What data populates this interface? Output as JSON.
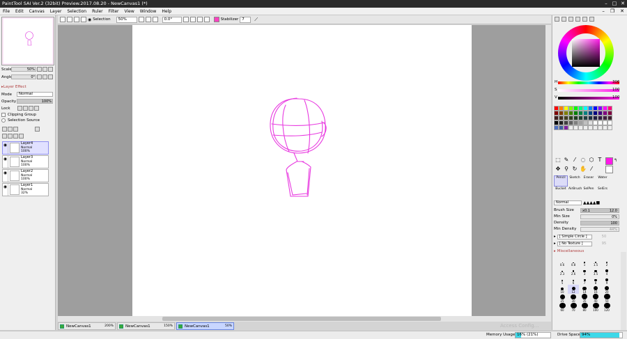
{
  "title": "PaintTool SAI Ver.2 (32bit) Preview.2017.08.20 - NewCanvas1 (*)",
  "menu": [
    "File",
    "Edit",
    "Canvas",
    "Layer",
    "Selection",
    "Ruler",
    "Filter",
    "View",
    "Window",
    "Help"
  ],
  "toolbar": {
    "selection_label": "Selection",
    "zoom": "50%",
    "angle": "0.0°",
    "stabilizer_label": "Stabilizer",
    "stabilizer_value": "7"
  },
  "left": {
    "scale_label": "Scale",
    "scale_value": "50%",
    "angle_label": "Angle",
    "angle_value": "0°",
    "layer_effect": "Layer Effect",
    "mode_label": "Mode",
    "mode_value": "Normal",
    "opacity_label": "Opacity",
    "opacity_value": "100%",
    "lock_label": "Lock",
    "clipping_group": "Clipping Group",
    "selection_source": "Selection Source"
  },
  "layers": [
    {
      "name": "Layer4",
      "mode": "Normal",
      "opacity": "100%",
      "selected": true
    },
    {
      "name": "Layer3",
      "mode": "Normal",
      "opacity": "100%",
      "selected": false
    },
    {
      "name": "Layer2",
      "mode": "Normal",
      "opacity": "100%",
      "selected": false
    },
    {
      "name": "Layer1",
      "mode": "Normal",
      "opacity": "32%",
      "selected": false
    }
  ],
  "canvas_tabs": [
    {
      "name": "NewCanvas1",
      "zoom": "200%"
    },
    {
      "name": "NewCanvas1",
      "zoom": "150%"
    },
    {
      "name": "NewCanvas1",
      "zoom": "50%"
    }
  ],
  "status": {
    "memory_label": "Memory Usage",
    "memory_value": "16% (21%)",
    "drive_label": "Drive Space",
    "drive_value": "94%",
    "watermark": "Access Config…"
  },
  "color": {
    "h_label": "H",
    "h_value": "306",
    "s_label": "S",
    "s_value": "100",
    "v_label": "V",
    "v_value": "100",
    "current": "#ff19e8"
  },
  "brushes": [
    "Pencil",
    "Sketch",
    "Eraser",
    "Water",
    "Bucket",
    "AirBrush",
    "SelPen",
    "SelErs"
  ],
  "brush_props": {
    "blend_mode": "Normal",
    "brush_size_label": "Brush Size",
    "brush_size_mult": "x0.1",
    "brush_size_value": "12.0",
    "min_size_label": "Min Size",
    "min_size_value": "0%",
    "density_label": "Density",
    "density_value": "100",
    "min_density_label": "Min Density",
    "min_density_value": "44%",
    "shape": "[ Simple Circle ]",
    "shape_val": "50",
    "texture": "[ No Texture ]",
    "texture_val": "95",
    "misc": "Miscellaneous"
  },
  "brush_sizes": [
    "0.6",
    "0.8",
    "1",
    "1.5",
    "2",
    "2.3",
    "2.6",
    "3",
    "3.5",
    "4",
    "5",
    "6",
    "7",
    "8",
    "9",
    "10",
    "12",
    "14",
    "16",
    "20",
    "25",
    "30",
    "35",
    "40",
    "50",
    "60",
    "70",
    "80",
    "100",
    "120"
  ],
  "accent": "#ff33cc"
}
